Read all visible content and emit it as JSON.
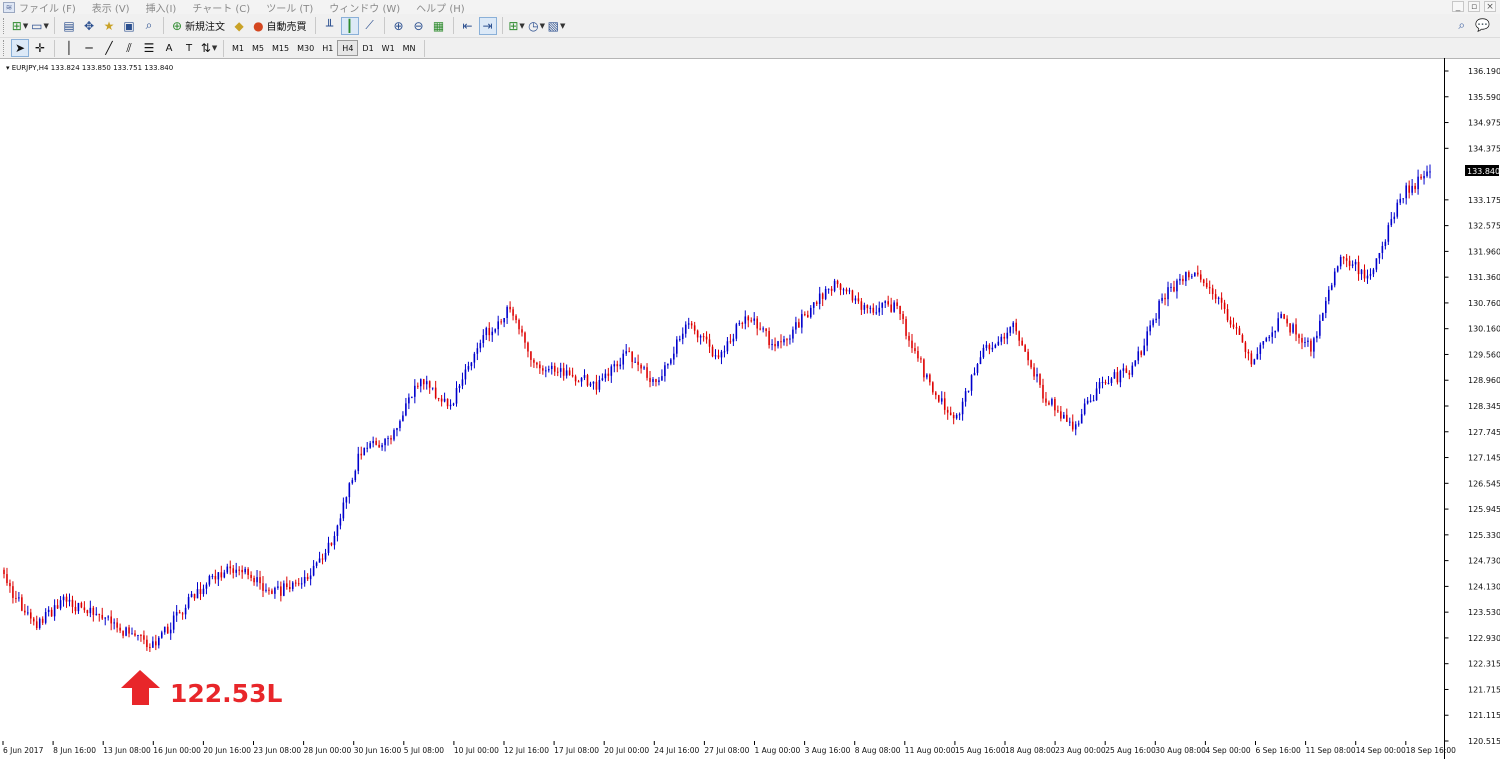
{
  "menubar": {
    "items": [
      "ファイル (F)",
      "表示 (V)",
      "挿入(I)",
      "チャート (C)",
      "ツール (T)",
      "ウィンドウ (W)",
      "ヘルプ (H)"
    ]
  },
  "toolbar": {
    "new_order_label": "新規注文",
    "autotrading_label": "自動売買"
  },
  "timeframes": [
    "M1",
    "M5",
    "M15",
    "M30",
    "H1",
    "H4",
    "D1",
    "W1",
    "MN"
  ],
  "active_timeframe": "H4",
  "chart": {
    "header": "EURJPY,H4  133.824 133.850 133.751 133.840",
    "current_price": "133.840",
    "annotation": "122.53L",
    "colors": {
      "bull": "#0000cc",
      "bear": "#dd0000",
      "annotation": "#e8262a",
      "price_tag_bg": "#000000"
    }
  },
  "chart_data": {
    "type": "candlestick",
    "symbol": "EURJPY",
    "timeframe": "H4",
    "ohlc_last": {
      "open": 133.824,
      "high": 133.85,
      "low": 133.751,
      "close": 133.84
    },
    "y_ticks": [
      "136.190",
      "135.590",
      "134.975",
      "134.375",
      "133.840",
      "133.175",
      "132.575",
      "131.960",
      "131.360",
      "130.760",
      "130.160",
      "129.560",
      "128.960",
      "128.345",
      "127.745",
      "127.145",
      "126.545",
      "125.945",
      "125.330",
      "124.730",
      "124.130",
      "123.530",
      "122.930",
      "122.315",
      "121.715",
      "121.115",
      "120.515"
    ],
    "y_range": [
      120.5,
      136.3
    ],
    "x_ticks": [
      "6 Jun 2017",
      "8 Jun 16:00",
      "13 Jun 08:00",
      "16 Jun 00:00",
      "20 Jun 16:00",
      "23 Jun 08:00",
      "28 Jun 00:00",
      "30 Jun 16:00",
      "5 Jul 08:00",
      "10 Jul 00:00",
      "12 Jul 16:00",
      "17 Jul 08:00",
      "20 Jul 00:00",
      "24 Jul 16:00",
      "27 Jul 08:00",
      "1 Aug 00:00",
      "3 Aug 16:00",
      "8 Aug 08:00",
      "11 Aug 00:00",
      "15 Aug 16:00",
      "18 Aug 08:00",
      "23 Aug 00:00",
      "25 Aug 16:00",
      "30 Aug 08:00",
      "4 Sep 00:00",
      "6 Sep 16:00",
      "11 Sep 08:00",
      "14 Sep 00:00",
      "18 Sep 16:00"
    ],
    "anchor_closes": [
      124.3,
      123.2,
      123.8,
      123.5,
      123.1,
      122.7,
      123.6,
      124.4,
      124.6,
      123.95,
      124.25,
      125.1,
      127.3,
      127.6,
      128.95,
      128.3,
      129.9,
      130.6,
      129.2,
      129.15,
      128.8,
      129.6,
      128.8,
      130.3,
      129.5,
      130.5,
      129.7,
      130.5,
      131.3,
      130.6,
      130.7,
      129.1,
      128.0,
      129.7,
      130.2,
      128.6,
      127.9,
      128.9,
      129.2,
      130.9,
      131.5,
      130.7,
      129.4,
      130.4,
      129.7,
      131.9,
      131.3,
      133.3,
      133.8
    ],
    "annotation_low": 122.53
  }
}
